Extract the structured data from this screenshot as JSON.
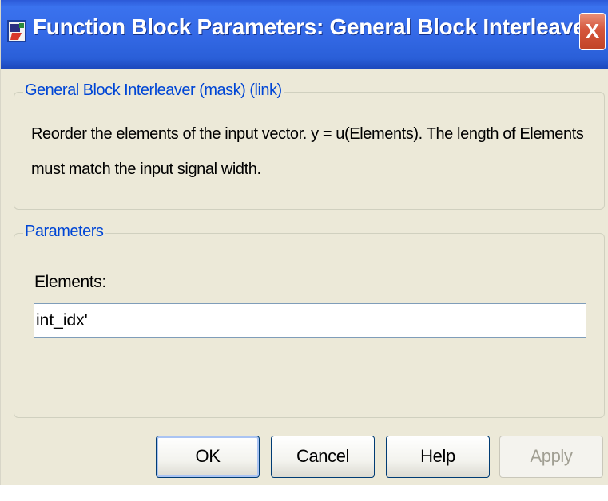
{
  "window": {
    "title": "Function Block Parameters: General Block Interleaver",
    "close_label": "X"
  },
  "description_group": {
    "legend": "General Block Interleaver (mask) (link)",
    "line1": "Reorder the elements of the input vector. y = u(Elements). The length of Elements",
    "line2": "must match the input signal width."
  },
  "parameters_group": {
    "legend": "Parameters",
    "elements_label": "Elements:",
    "elements_value": "int_idx'"
  },
  "buttons": {
    "ok": "OK",
    "cancel": "Cancel",
    "help": "Help",
    "apply": "Apply"
  },
  "colors": {
    "titlebar": "#3469e6",
    "legend_text": "#0046d5",
    "dialog_bg": "#ece9d8"
  }
}
